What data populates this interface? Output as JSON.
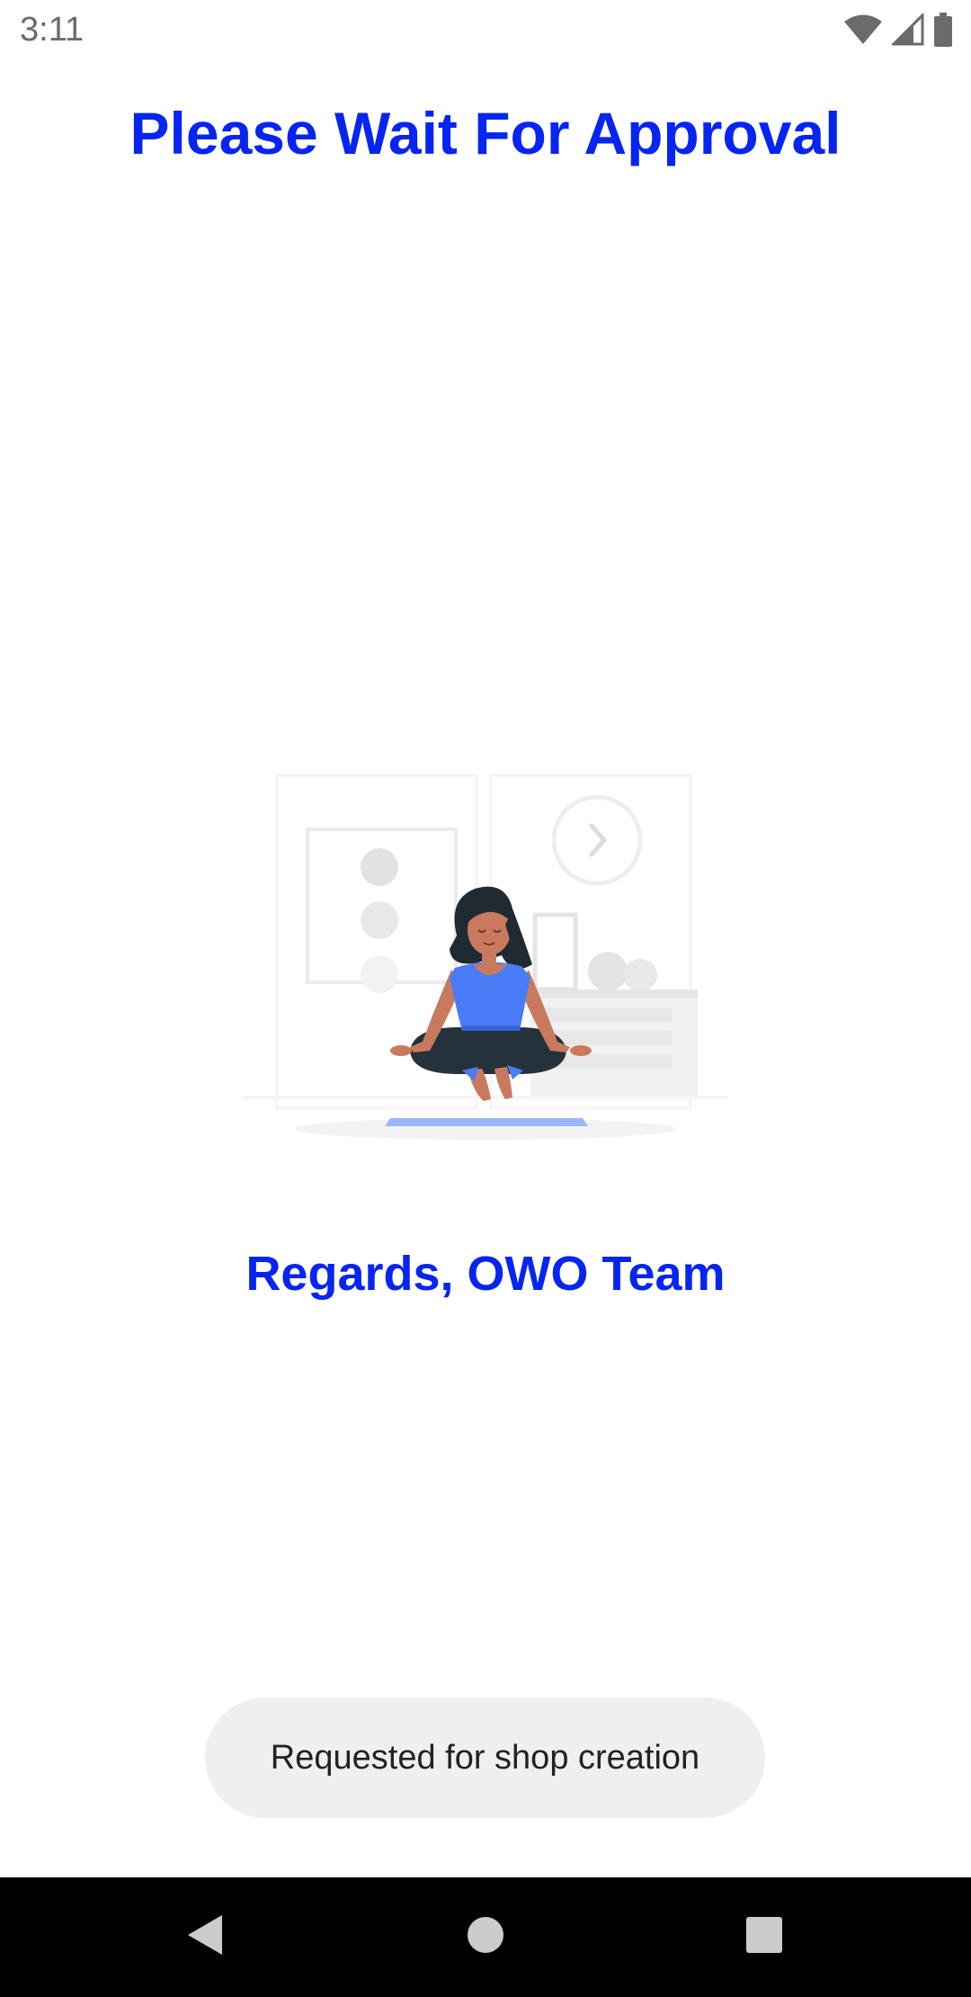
{
  "status_bar": {
    "time": "3:11",
    "icons": [
      "wifi-icon",
      "cellular-signal-icon",
      "battery-icon"
    ]
  },
  "main": {
    "title": "Please Wait For Approval",
    "illustration": "meditating-woman-illustration",
    "regards": "Regards, OWO Team"
  },
  "toast": {
    "message": "Requested for shop creation"
  },
  "nav_bar": {
    "buttons": [
      "back-icon",
      "home-icon",
      "recents-icon"
    ]
  },
  "colors": {
    "accent": "#0625f0",
    "toast_bg": "#efefef",
    "nav_bg": "#000000",
    "illustration_blue": "#4a7cf7"
  }
}
